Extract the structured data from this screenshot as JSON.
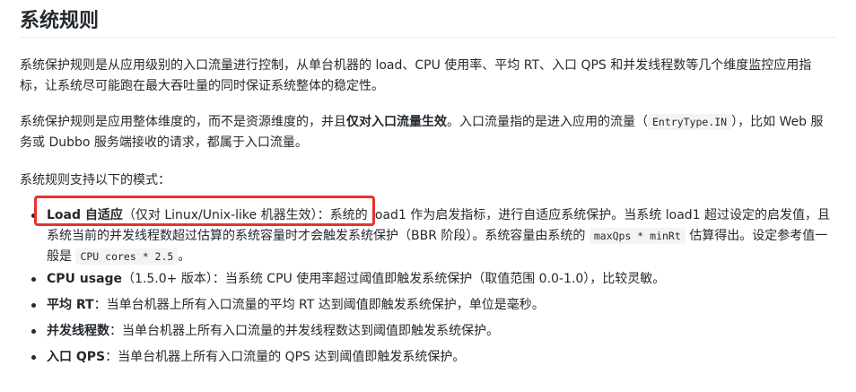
{
  "title": "系统规则",
  "para1": "系统保护规则是从应用级别的入口流量进行控制，从单台机器的 load、CPU 使用率、平均 RT、入口 QPS 和并发线程数等几个维度监控应用指标，让系统尽可能跑在最大吞吐量的同时保证系统整体的稳定性。",
  "para2": {
    "before": "系统保护规则是应用整体维度的，而不是资源维度的，并且",
    "bold": "仅对入口流量生效",
    "after": "。入口流量指的是进入应用的流量（",
    "code": "EntryType.IN",
    "tail": "），比如 Web 服务或 Dubbo 服务端接收的请求，都属于入口流量。"
  },
  "para3": "系统规则支持以下的模式：",
  "modes": [
    {
      "bold": "Load 自适应",
      "text1": "（仅对 Linux/Unix-like 机器生效）：系统的 load1 作为启发指标，进行自适应系统保护。当系统 load1 超过设定的启发值，且系统当前的并发线程数超过估算的系统容量时才会触发系统保护（BBR 阶段）。系统容量由系统的 ",
      "code1": "maxQps * minRt",
      "text2": " 估算得出。设定参考值一般是 ",
      "code2": "CPU cores * 2.5",
      "text3": "。"
    },
    {
      "bold": "CPU usage",
      "text1": "（1.5.0+ 版本）：当系统 CPU 使用率超过阈值即触发系统保护（取值范围 0.0-1.0），比较灵敏。"
    },
    {
      "bold": "平均 RT",
      "text1": "：当单台机器上所有入口流量的平均 RT 达到阈值即触发系统保护，单位是毫秒。"
    },
    {
      "bold": "并发线程数",
      "text1": "：当单台机器上所有入口流量的并发线程数达到阈值即触发系统保护。"
    },
    {
      "bold": "入口 QPS",
      "text1": "：当单台机器上所有入口流量的 QPS 达到阈值即触发系统保护。"
    }
  ],
  "colors": {
    "highlight_box": "#e5322d",
    "text": "#24292e",
    "code_bg": "#f3f4f4"
  }
}
